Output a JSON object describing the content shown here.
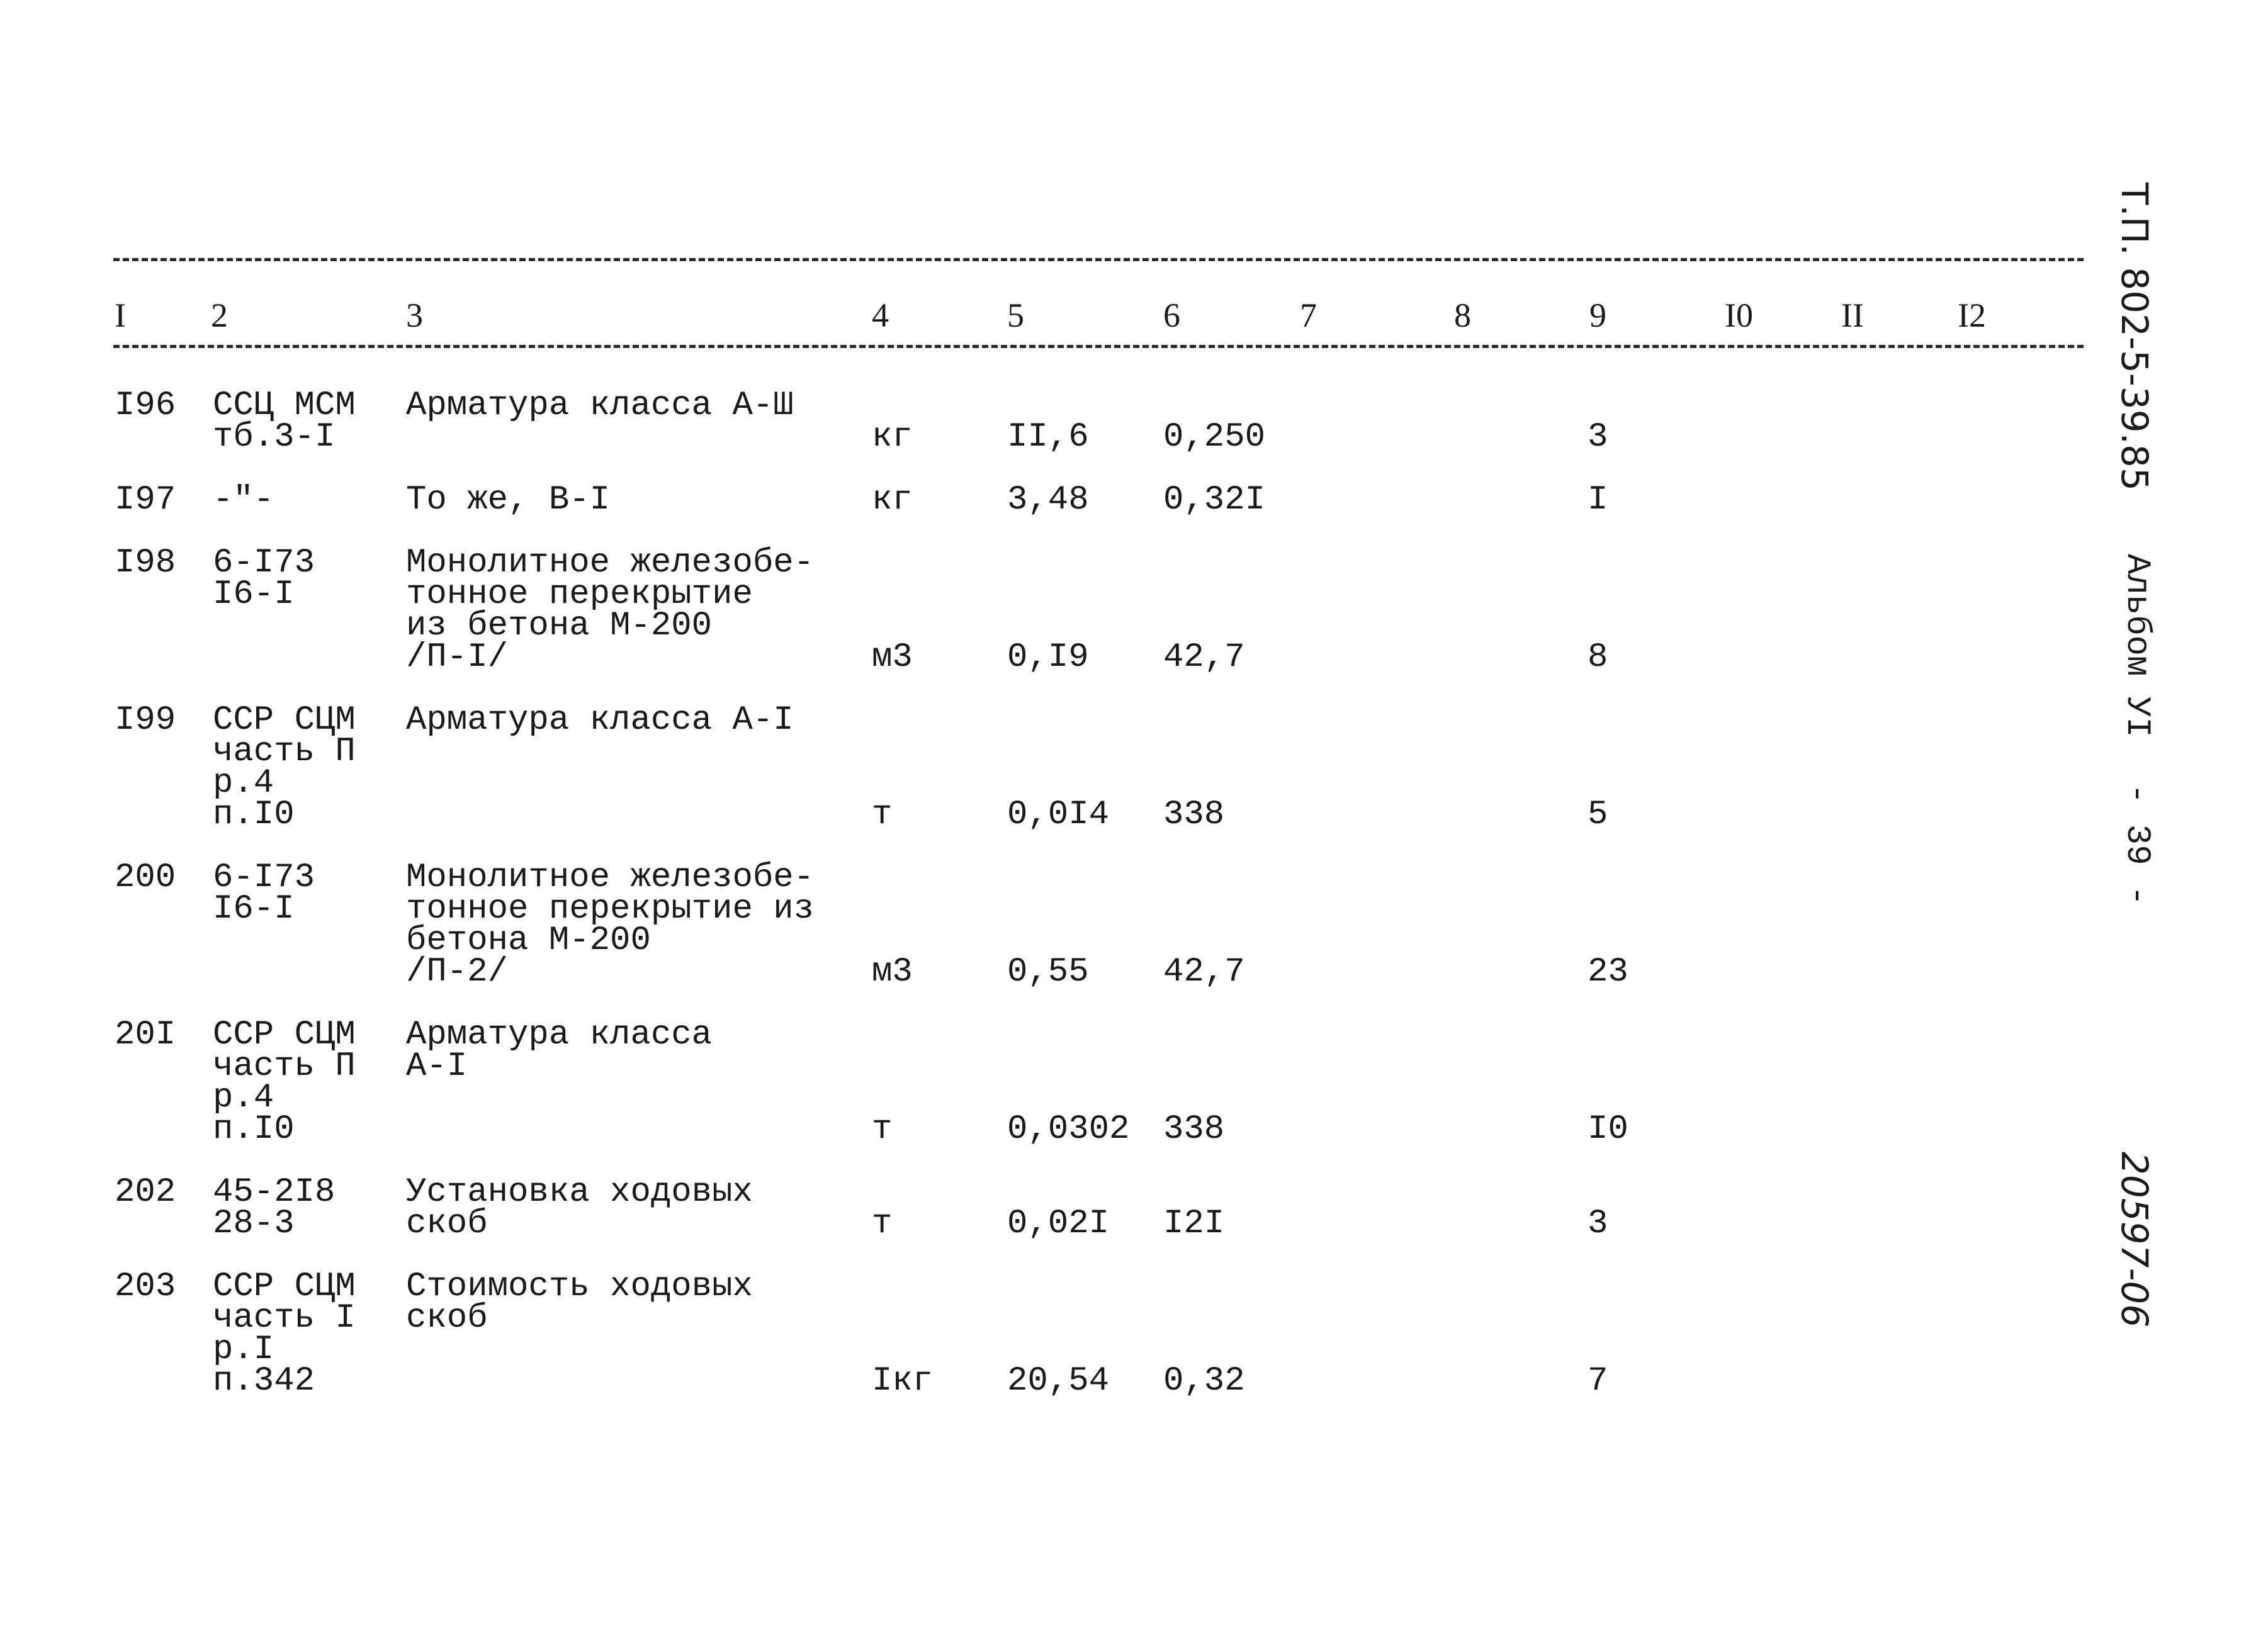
{
  "document": {
    "column_headers": [
      "I",
      "2",
      "3",
      "4",
      "5",
      "6",
      "7",
      "8",
      "9",
      "I0",
      "II",
      "I2"
    ],
    "rows": [
      {
        "no": "I96",
        "code": [
          "ССЦ МСМ",
          "тб.3-I"
        ],
        "name": [
          "Арматура класса А-Ш"
        ],
        "unit": "кг",
        "qty": "II,6",
        "price": "0,250",
        "col9": "3"
      },
      {
        "no": "I97",
        "code": [
          "-\"-"
        ],
        "name": [
          "То же, В-I"
        ],
        "unit": "кг",
        "qty": "3,48",
        "price": "0,32I",
        "col9": "I"
      },
      {
        "no": "I98",
        "code": [
          "6-I73",
          "I6-I"
        ],
        "name": [
          "Монолитное железобе-",
          "тонное перекрытие",
          "из бетона М-200",
          "/П-I/"
        ],
        "unit": "м3",
        "qty": "0,I9",
        "price": "42,7",
        "col9": "8"
      },
      {
        "no": "I99",
        "code": [
          "ССР СЦМ",
          "часть П",
          "р.4",
          "п.I0"
        ],
        "name": [
          "Арматура класса А-I"
        ],
        "unit": "т",
        "qty": "0,0I4",
        "price": "338",
        "col9": "5"
      },
      {
        "no": "200",
        "code": [
          "6-I73",
          "I6-I"
        ],
        "name": [
          "Монолитное железобе-",
          "тонное перекрытие из",
          "бетона М-200",
          "/П-2/"
        ],
        "unit": "м3",
        "qty": "0,55",
        "price": "42,7",
        "col9": "23"
      },
      {
        "no": "20I",
        "code": [
          "ССР СЦМ",
          "часть П",
          "р.4",
          "п.I0"
        ],
        "name": [
          "Арматура класса",
          "А-I"
        ],
        "unit": "т",
        "qty": "0,0302",
        "price": "338",
        "col9": "I0"
      },
      {
        "no": "202",
        "code": [
          "45-2I8",
          "28-3"
        ],
        "name": [
          "Установка ходовых",
          "скоб"
        ],
        "unit": "т",
        "qty": "0,02I",
        "price": "I2I",
        "col9": "3"
      },
      {
        "no": "203",
        "code": [
          "ССР СЦМ",
          "часть I",
          "р.I",
          "п.342"
        ],
        "name": [
          "Стоимость ходовых",
          "скоб"
        ],
        "unit": "Iкг",
        "qty": "20,54",
        "price": "0,32",
        "col9": "7"
      }
    ]
  },
  "margin": {
    "project": "Т.П. 802-5-39.85",
    "album": "Альбом УI",
    "page": "- 39 -",
    "inventory": "20597-06"
  }
}
